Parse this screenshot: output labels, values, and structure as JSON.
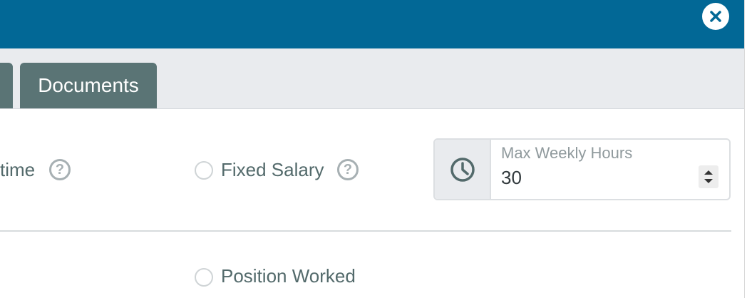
{
  "modal": {
    "close_label": "✕"
  },
  "tabs": {
    "documents_label": "Documents"
  },
  "pay_type": {
    "overtime_label_partial": "time",
    "help_glyph": "?",
    "fixed_salary_label": "Fixed Salary"
  },
  "max_weekly_hours": {
    "label": "Max Weekly Hours",
    "value": "30",
    "icon": "clock-icon"
  },
  "position_worked_label": "Position Worked",
  "colors": {
    "header": "#026896",
    "tab": "#5a7475",
    "text": "#536a6b"
  }
}
